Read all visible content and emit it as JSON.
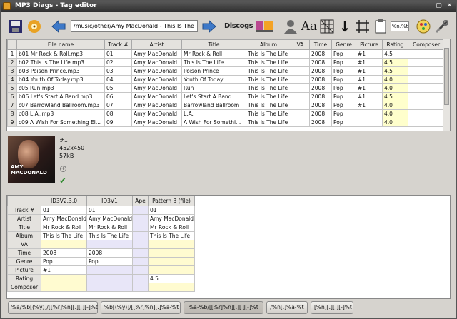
{
  "window": {
    "title": "MP3 Diags - Tag editor",
    "minimize_glyph": "▢",
    "close_glyph": "✕"
  },
  "toolbar": {
    "path": "/music/other/Amy MacDonald - This Is The Life",
    "discogs_label": "Discogs",
    "pattern_short": "%n.%t",
    "icons": [
      "save-icon",
      "reload-icon",
      "prev-folder-icon",
      "next-folder-icon",
      "discogs-icon",
      "musicbrainz-icon",
      "person-icon",
      "case-icon",
      "grid-icon",
      "sort-icon",
      "table-icon",
      "paste-icon",
      "pattern-field",
      "config-icon",
      "tools-icon"
    ],
    "case_glyph": "Aa",
    "sort_glyph": "↓"
  },
  "files": {
    "columns": [
      "File name",
      "Track #",
      "Artist",
      "Title",
      "Album",
      "VA",
      "Time",
      "Genre",
      "Picture",
      "Rating",
      "Composer"
    ],
    "rows": [
      {
        "num": "1",
        "file": "b01 Mr Rock & Roll.mp3",
        "track": "01",
        "artist": "Amy MacDonald",
        "title": "Mr Rock & Roll",
        "album": "This Is The Life",
        "va": "",
        "time": "2008",
        "genre": "Pop",
        "picture": "#1",
        "rating": "4.5",
        "composer": ""
      },
      {
        "num": "2",
        "file": "b02 This Is The Life.mp3",
        "track": "02",
        "artist": "Amy MacDonald",
        "title": "This Is The Life",
        "album": "This Is The Life",
        "va": "",
        "time": "2008",
        "genre": "Pop",
        "picture": "#1",
        "rating": "4.5",
        "composer": ""
      },
      {
        "num": "3",
        "file": "b03 Poison Prince.mp3",
        "track": "03",
        "artist": "Amy MacDonald",
        "title": "Poison Prince",
        "album": "This Is The Life",
        "va": "",
        "time": "2008",
        "genre": "Pop",
        "picture": "#1",
        "rating": "4.5",
        "composer": ""
      },
      {
        "num": "4",
        "file": "b04 Youth Of Today.mp3",
        "track": "04",
        "artist": "Amy MacDonald",
        "title": "Youth Of Today",
        "album": "This Is The Life",
        "va": "",
        "time": "2008",
        "genre": "Pop",
        "picture": "#1",
        "rating": "4.0",
        "composer": ""
      },
      {
        "num": "5",
        "file": "c05 Run.mp3",
        "track": "05",
        "artist": "Amy MacDonald",
        "title": "Run",
        "album": "This Is The Life",
        "va": "",
        "time": "2008",
        "genre": "Pop",
        "picture": "#1",
        "rating": "4.0",
        "composer": ""
      },
      {
        "num": "6",
        "file": "b06 Let's Start A Band.mp3",
        "track": "06",
        "artist": "Amy MacDonald",
        "title": "Let's Start A Band",
        "album": "This Is The Life",
        "va": "",
        "time": "2008",
        "genre": "Pop",
        "picture": "#1",
        "rating": "4.5",
        "composer": ""
      },
      {
        "num": "7",
        "file": "c07 Barrowland Ballroom.mp3",
        "track": "07",
        "artist": "Amy MacDonald",
        "title": "Barrowland Ballroom",
        "album": "This Is The Life",
        "va": "",
        "time": "2008",
        "genre": "Pop",
        "picture": "#1",
        "rating": "4.0",
        "composer": ""
      },
      {
        "num": "8",
        "file": "c08 L.A..mp3",
        "track": "08",
        "artist": "Amy MacDonald",
        "title": "L.A.",
        "album": "This Is The Life",
        "va": "",
        "time": "2008",
        "genre": "Pop",
        "picture": "",
        "rating": "4.0",
        "composer": ""
      },
      {
        "num": "9",
        "file": "c09 A Wish For Something El...",
        "track": "09",
        "artist": "Amy MacDonald",
        "title": "A Wish For Somethi...",
        "album": "This Is The Life",
        "va": "",
        "time": "2008",
        "genre": "Pop",
        "picture": "",
        "rating": "4.0",
        "composer": ""
      }
    ]
  },
  "cover": {
    "picture_num": "#1",
    "dimensions": "452x450",
    "size": "57kB",
    "artist_text": "AMY MACDONALD",
    "add_glyph": "+",
    "ok_glyph": "✔"
  },
  "tags": {
    "columns": [
      "ID3V2.3.0",
      "ID3V1",
      "Ape",
      "Pattern 3 (file)"
    ],
    "rows": [
      {
        "field": "Track #",
        "id3v2": "01",
        "id3v1": "01",
        "ape": "",
        "pattern": "01"
      },
      {
        "field": "Artist",
        "id3v2": "Amy MacDonald",
        "id3v1": "Amy MacDonald",
        "ape": "",
        "pattern": "Amy MacDonald"
      },
      {
        "field": "Title",
        "id3v2": "Mr Rock & Roll",
        "id3v1": "Mr Rock & Roll",
        "ape": "",
        "pattern": "Mr Rock & Roll"
      },
      {
        "field": "Album",
        "id3v2": "This Is The Life",
        "id3v1": "This Is The Life",
        "ape": "",
        "pattern": "This Is The Life"
      },
      {
        "field": "VA",
        "id3v2": "",
        "id3v1": "",
        "ape": "",
        "pattern": ""
      },
      {
        "field": "Time",
        "id3v2": "2008",
        "id3v1": "2008",
        "ape": "",
        "pattern": ""
      },
      {
        "field": "Genre",
        "id3v2": "Pop",
        "id3v1": "Pop",
        "ape": "",
        "pattern": ""
      },
      {
        "field": "Picture",
        "id3v2": "#1",
        "id3v1": "",
        "ape": "",
        "pattern": ""
      },
      {
        "field": "Rating",
        "id3v2": "",
        "id3v1": "",
        "ape": "",
        "pattern": "4.5"
      },
      {
        "field": "Composer",
        "id3v2": "",
        "id3v1": "",
        "ape": "",
        "pattern": ""
      }
    ]
  },
  "patterns": [
    "%a/%b[(%y)]/[[%r]%n][.][ ][-]%t",
    "%b[(%y)]/[[%r]%n][.]%a-%t",
    "%a-%b/[[%r]%n][.][ ][-]%t",
    "/%n[.]%a-%t",
    "[%n][.][ ][-]%t"
  ],
  "active_pattern_index": 2,
  "colors": {
    "rating_bg": "#ffffcc",
    "header_bg": "#e4e2de",
    "window_bg": "#d6d3ce"
  }
}
